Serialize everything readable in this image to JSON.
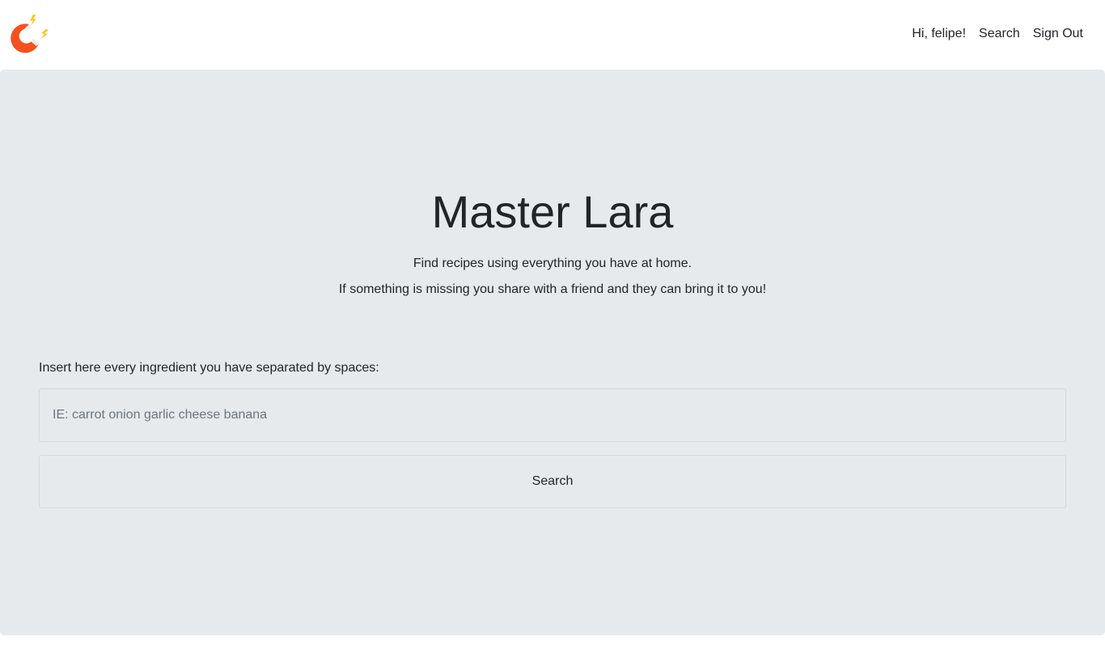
{
  "navbar": {
    "logo_icon": "magnet-icon",
    "greeting": "Hi, felipe!",
    "search_link": "Search",
    "signout_link": "Sign Out"
  },
  "hero": {
    "title": "Master Lara",
    "line1": "Find recipes using everything you have at home.",
    "line2": "If something is missing you share with a friend and they can bring it to you!"
  },
  "form": {
    "label": "Insert here every ingredient you have separated by spaces:",
    "input_value": "",
    "input_placeholder": "IE: carrot onion garlic cheese banana",
    "button_label": "Search"
  },
  "colors": {
    "jumbotron_bg": "#e7eaed",
    "logo_red": "#f4511e",
    "logo_yellow": "#f9c31f"
  }
}
